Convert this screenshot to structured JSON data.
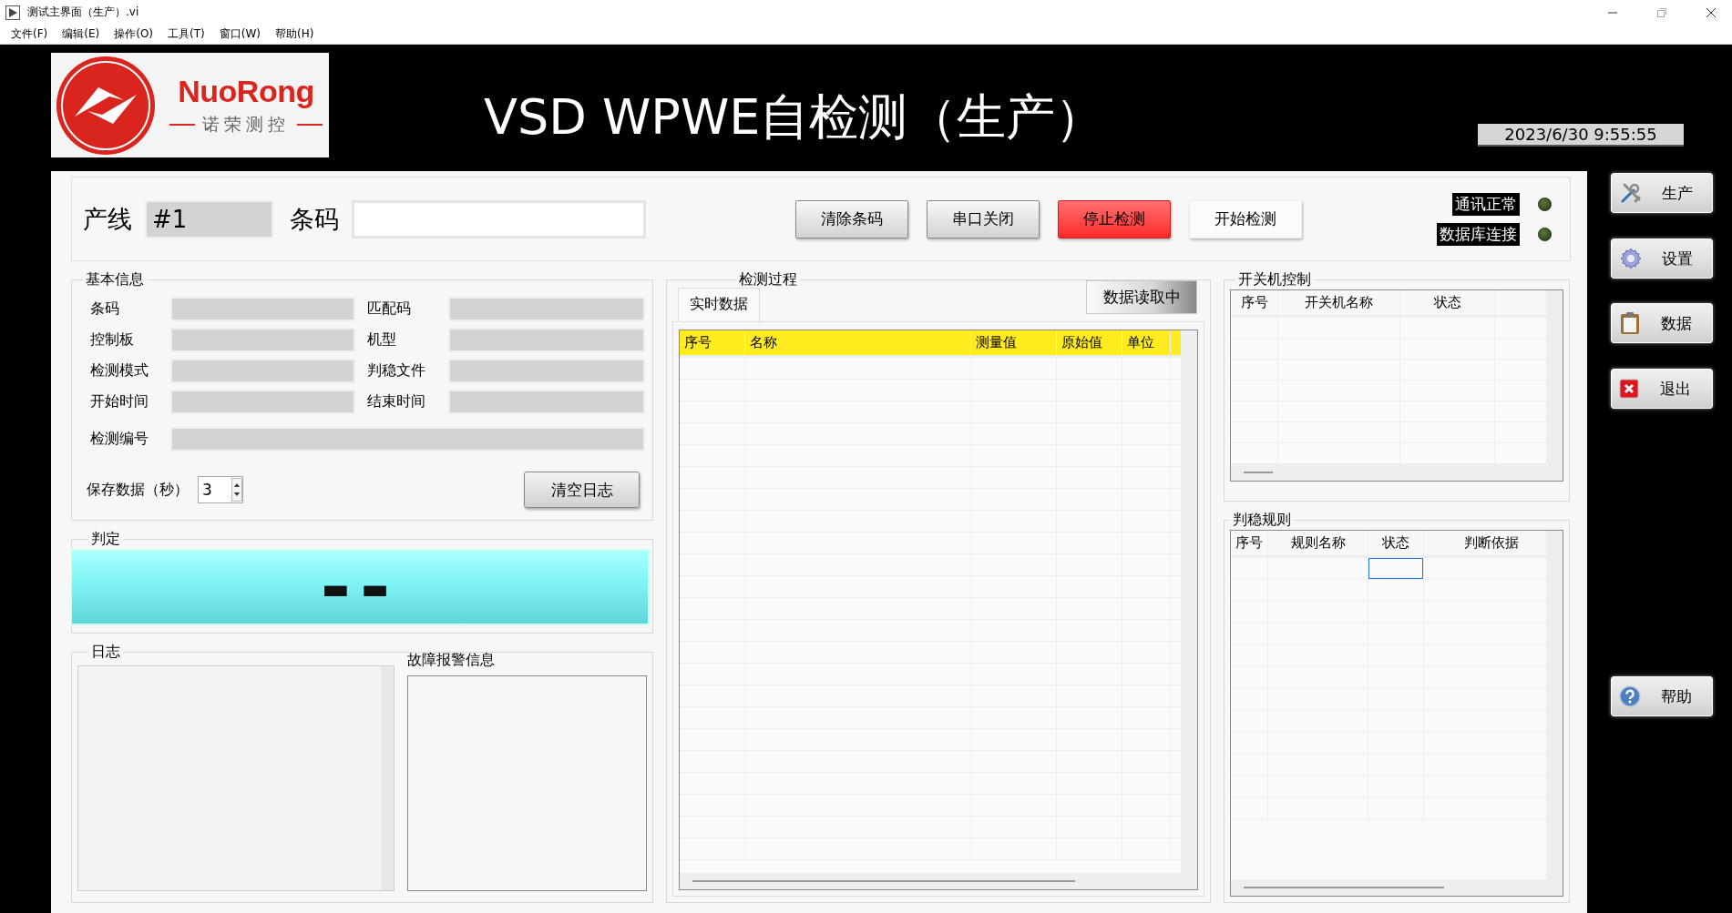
{
  "window": {
    "title": "测试主界面（生产）.vi"
  },
  "menu": [
    "文件(F)",
    "编辑(E)",
    "操作(O)",
    "工具(T)",
    "窗口(W)",
    "帮助(H)"
  ],
  "header": {
    "logo_name": "NuoRong",
    "logo_subtitle": "诺荣测控",
    "title": "VSD WPWE自检测（生产）",
    "datetime": "2023/6/30 9:55:55"
  },
  "top_bar": {
    "line_label": "产线",
    "line_value": "#1",
    "barcode_label": "条码",
    "buttons": [
      {
        "label": "清除条码",
        "kind": "normal"
      },
      {
        "label": "串口关闭",
        "kind": "normal"
      },
      {
        "label": "停止检测",
        "kind": "danger"
      },
      {
        "label": "开始检测",
        "kind": "flat"
      }
    ],
    "indicators": [
      {
        "label": "通讯正常",
        "on": false
      },
      {
        "label": "数据库连接",
        "on": false
      }
    ]
  },
  "basic_info": {
    "title": "基本信息",
    "fields": [
      {
        "label": "条码"
      },
      {
        "label": "匹配码"
      },
      {
        "label": "控制板"
      },
      {
        "label": "机型"
      },
      {
        "label": "检测模式"
      },
      {
        "label": "判稳文件"
      },
      {
        "label": "开始时间"
      },
      {
        "label": "结束时间"
      }
    ],
    "wide_field": {
      "label": "检测编号"
    },
    "save_label": "保存数据（秒）",
    "save_value": "3",
    "clear_button": "清空日志"
  },
  "judgment": {
    "title": "判定",
    "value": "--"
  },
  "log": {
    "title": "日志"
  },
  "alarm": {
    "title": "故障报警信息"
  },
  "process": {
    "title": "检测过程",
    "tabs": [
      {
        "label": "实时数据",
        "selected": true
      }
    ],
    "status_button": "数据读取中",
    "columns": [
      "序号",
      "名称",
      "测量值",
      "原始值",
      "单位"
    ]
  },
  "power_control": {
    "title": "开关机控制",
    "columns": [
      "序号",
      "开关机名称",
      "状态"
    ]
  },
  "stability_rules": {
    "title": "判稳规则",
    "columns": [
      "序号",
      "规则名称",
      "状态",
      "判断依据"
    ]
  },
  "sidebar": [
    {
      "label": "生产",
      "kind": "tools"
    },
    {
      "label": "设置",
      "kind": "gear"
    },
    {
      "label": "数据",
      "kind": "clipboard"
    },
    {
      "label": "退出",
      "kind": "exit"
    },
    {
      "label": "帮助",
      "kind": "help"
    }
  ]
}
